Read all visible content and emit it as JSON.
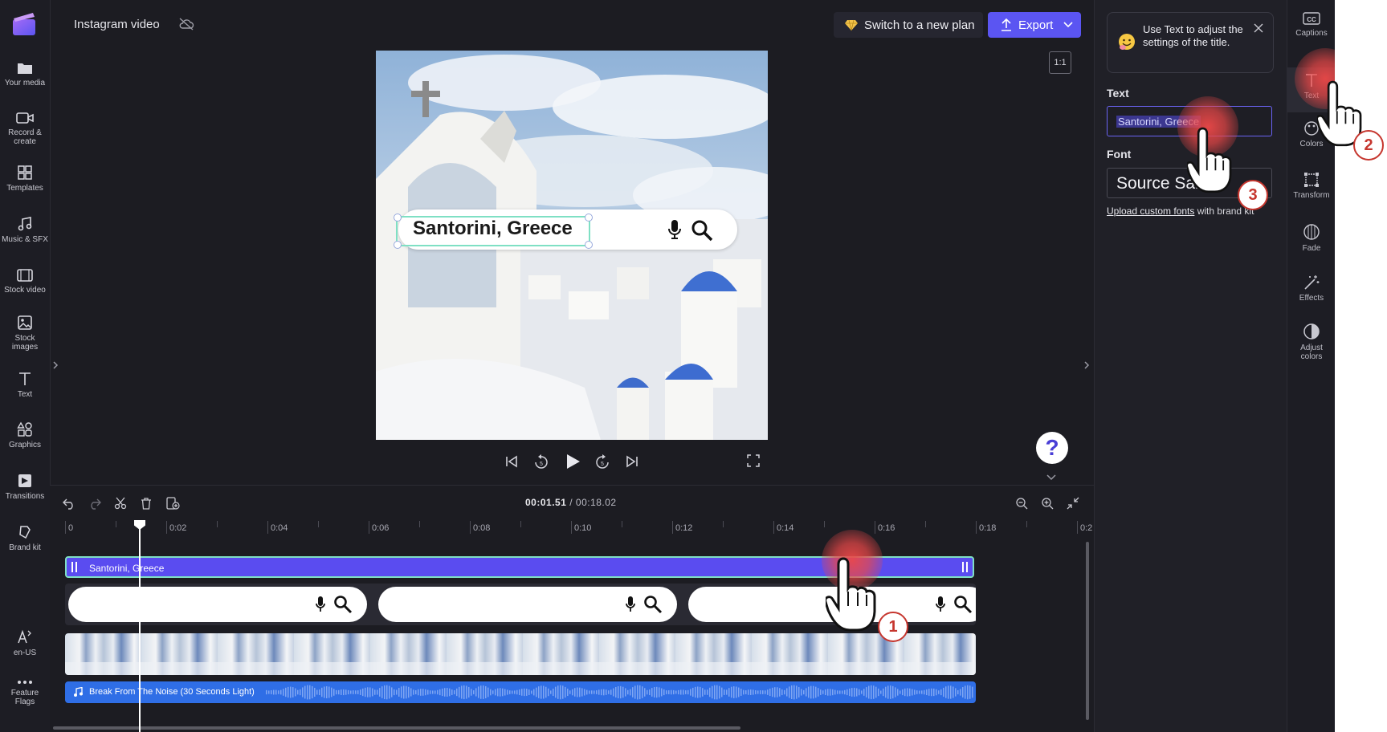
{
  "app": {
    "project_title": "Instagram video"
  },
  "leftnav": {
    "items": [
      {
        "label": "Your media",
        "icon": "folder-icon"
      },
      {
        "label": "Record &\ncreate",
        "icon": "video-camera-icon"
      },
      {
        "label": "Templates",
        "icon": "templates-icon"
      },
      {
        "label": "Music & SFX",
        "icon": "music-note-icon"
      },
      {
        "label": "Stock video",
        "icon": "film-icon"
      },
      {
        "label": "Stock\nimages",
        "icon": "image-icon"
      },
      {
        "label": "Text",
        "icon": "text-icon"
      },
      {
        "label": "Graphics",
        "icon": "shapes-icon"
      },
      {
        "label": "Transitions",
        "icon": "transition-icon"
      },
      {
        "label": "Brand kit",
        "icon": "brand-kit-icon"
      }
    ],
    "bottom_items": [
      {
        "label": "en-US",
        "icon": "language-icon"
      },
      {
        "label": "Feature\nFlags",
        "icon": "more-dots-icon"
      }
    ]
  },
  "topbar": {
    "plan_button": "Switch to a new plan",
    "export_button": "Export"
  },
  "preview": {
    "overlay_text": "Santorini, Greece",
    "aspect_ratio": "1:1",
    "help_label": "?"
  },
  "timeline": {
    "current_time": "00:01.51",
    "separator": " / ",
    "total_time": "00:18.02",
    "ruler": [
      "0",
      "0:02",
      "0:04",
      "0:06",
      "0:08",
      "0:10",
      "0:12",
      "0:14",
      "0:16",
      "0:18",
      "0:2"
    ],
    "text_track_label": "Santorini, Greece",
    "audio_track_label": "Break From The Noise (30 Seconds Light)"
  },
  "panel": {
    "tip": "Use Text to adjust the settings of the title.",
    "text_label": "Text",
    "text_value": "Santorini, Greece",
    "font_label": "Font",
    "font_value": "Source Sans",
    "upload_link": "Upload custom fonts",
    "upload_suffix": " with brand kit"
  },
  "rail": {
    "items": [
      {
        "label": "Captions",
        "icon": "captions-icon"
      },
      {
        "label": "Text",
        "icon": "text-icon"
      },
      {
        "label": "Colors",
        "icon": "palette-icon"
      },
      {
        "label": "Transform",
        "icon": "transform-icon"
      },
      {
        "label": "Fade",
        "icon": "fade-icon"
      },
      {
        "label": "Effects",
        "icon": "magic-wand-icon"
      },
      {
        "label": "Adjust\ncolors",
        "icon": "contrast-icon"
      }
    ]
  },
  "steps": [
    "1",
    "2",
    "3"
  ],
  "colors": {
    "accent": "#5b55f2",
    "text_track": "#5a4cf0",
    "audio_track": "#2f6ee6",
    "highlight": "#c6362e"
  }
}
